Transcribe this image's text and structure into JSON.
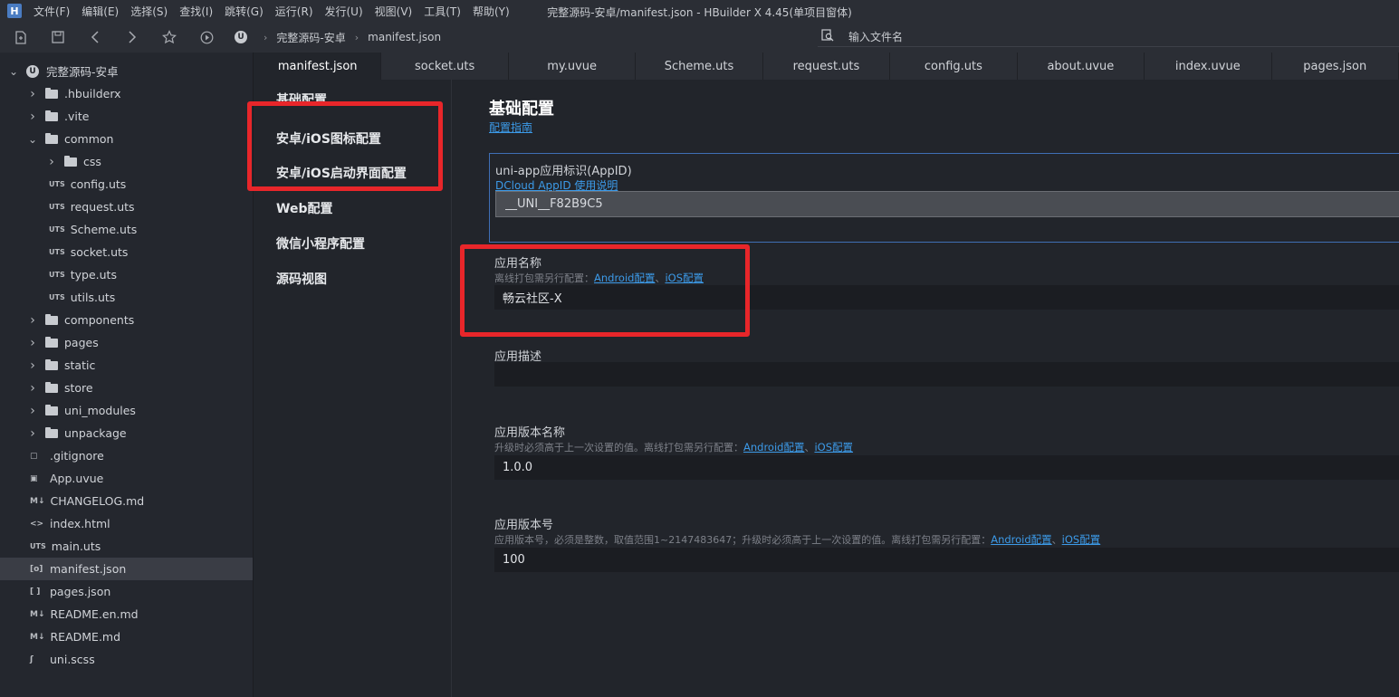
{
  "window": {
    "title": "完整源码-安卓/manifest.json - HBuilder X 4.45(单项目窗体)",
    "logo": "H"
  },
  "menu": [
    "文件(F)",
    "编辑(E)",
    "选择(S)",
    "查找(I)",
    "跳转(G)",
    "运行(R)",
    "发行(U)",
    "视图(V)",
    "工具(T)",
    "帮助(Y)"
  ],
  "toolbar": {
    "breadcrumb": [
      "完整源码-安卓",
      "manifest.json"
    ],
    "file_search_placeholder": "输入文件名",
    "project_logo": "U"
  },
  "tree": [
    {
      "label": "完整源码-安卓",
      "type": "root",
      "depth": 0,
      "expanded": true
    },
    {
      "label": ".hbuilderx",
      "type": "folder",
      "depth": 1,
      "expanded": false
    },
    {
      "label": ".vite",
      "type": "folder",
      "depth": 1,
      "expanded": false
    },
    {
      "label": "common",
      "type": "folder",
      "depth": 1,
      "expanded": true
    },
    {
      "label": "css",
      "type": "folder",
      "depth": 2,
      "expanded": false
    },
    {
      "label": "config.uts",
      "type": "file",
      "icon": "UTS",
      "depth": 2
    },
    {
      "label": "request.uts",
      "type": "file",
      "icon": "UTS",
      "depth": 2
    },
    {
      "label": "Scheme.uts",
      "type": "file",
      "icon": "UTS",
      "depth": 2
    },
    {
      "label": "socket.uts",
      "type": "file",
      "icon": "UTS",
      "depth": 2
    },
    {
      "label": "type.uts",
      "type": "file",
      "icon": "UTS",
      "depth": 2
    },
    {
      "label": "utils.uts",
      "type": "file",
      "icon": "UTS",
      "depth": 2
    },
    {
      "label": "components",
      "type": "folder",
      "depth": 1,
      "expanded": false
    },
    {
      "label": "pages",
      "type": "folder",
      "depth": 1,
      "expanded": false
    },
    {
      "label": "static",
      "type": "folder",
      "depth": 1,
      "expanded": false
    },
    {
      "label": "store",
      "type": "folder",
      "depth": 1,
      "expanded": false
    },
    {
      "label": "uni_modules",
      "type": "folder",
      "depth": 1,
      "expanded": false
    },
    {
      "label": "unpackage",
      "type": "folder",
      "depth": 1,
      "expanded": false
    },
    {
      "label": ".gitignore",
      "type": "file",
      "icon": "▢",
      "depth": 1
    },
    {
      "label": "App.uvue",
      "type": "file",
      "icon": "▣",
      "depth": 1
    },
    {
      "label": "CHANGELOG.md",
      "type": "file",
      "icon": "M↓",
      "depth": 1
    },
    {
      "label": "index.html",
      "type": "file",
      "icon": "<>",
      "depth": 1
    },
    {
      "label": "main.uts",
      "type": "file",
      "icon": "UTS",
      "depth": 1
    },
    {
      "label": "manifest.json",
      "type": "file",
      "icon": "[o]",
      "depth": 1,
      "selected": true
    },
    {
      "label": "pages.json",
      "type": "file",
      "icon": "[ ]",
      "depth": 1
    },
    {
      "label": "README.en.md",
      "type": "file",
      "icon": "M↓",
      "depth": 1
    },
    {
      "label": "README.md",
      "type": "file",
      "icon": "M↓",
      "depth": 1
    },
    {
      "label": "uni.scss",
      "type": "file",
      "icon": "ʃ",
      "depth": 1
    }
  ],
  "tabs": [
    {
      "label": "manifest.json",
      "active": true
    },
    {
      "label": "socket.uts"
    },
    {
      "label": "my.uvue"
    },
    {
      "label": "Scheme.uts"
    },
    {
      "label": "request.uts"
    },
    {
      "label": "config.uts"
    },
    {
      "label": "about.uvue"
    },
    {
      "label": "index.uvue"
    },
    {
      "label": "pages.json"
    }
  ],
  "config_nav": [
    "基础配置",
    "安卓/iOS图标配置",
    "安卓/iOS启动界面配置",
    "Web配置",
    "微信小程序配置",
    "源码视图"
  ],
  "main": {
    "title": "基础配置",
    "guide_link": "配置指南",
    "appid": {
      "label": "uni-app应用标识(AppID)",
      "help_link": "DCloud AppID 使用说明",
      "value": "__UNI__F82B9C5"
    },
    "app_name": {
      "label": "应用名称",
      "hint": "离线打包需另行配置：",
      "links": [
        "Android配置",
        "iOS配置"
      ],
      "value": "畅云社区-X"
    },
    "app_desc": {
      "label": "应用描述",
      "value": ""
    },
    "version_name": {
      "label": "应用版本名称",
      "hint": "升级时必须高于上一次设置的值。离线打包需另行配置：",
      "links": [
        "Android配置",
        "iOS配置"
      ],
      "value": "1.0.0"
    },
    "version_code": {
      "label": "应用版本号",
      "hint": "应用版本号，必须是整数，取值范围1~2147483647；升级时必须高于上一次设置的值。离线打包需另行配置：",
      "links": [
        "Android配置",
        "iOS配置"
      ],
      "value": "100"
    },
    "link_separator": "、"
  },
  "colors": {
    "accent_link": "#3c9ae8",
    "highlight_red": "#e8262a",
    "selected_border": "#3f6fb5"
  }
}
